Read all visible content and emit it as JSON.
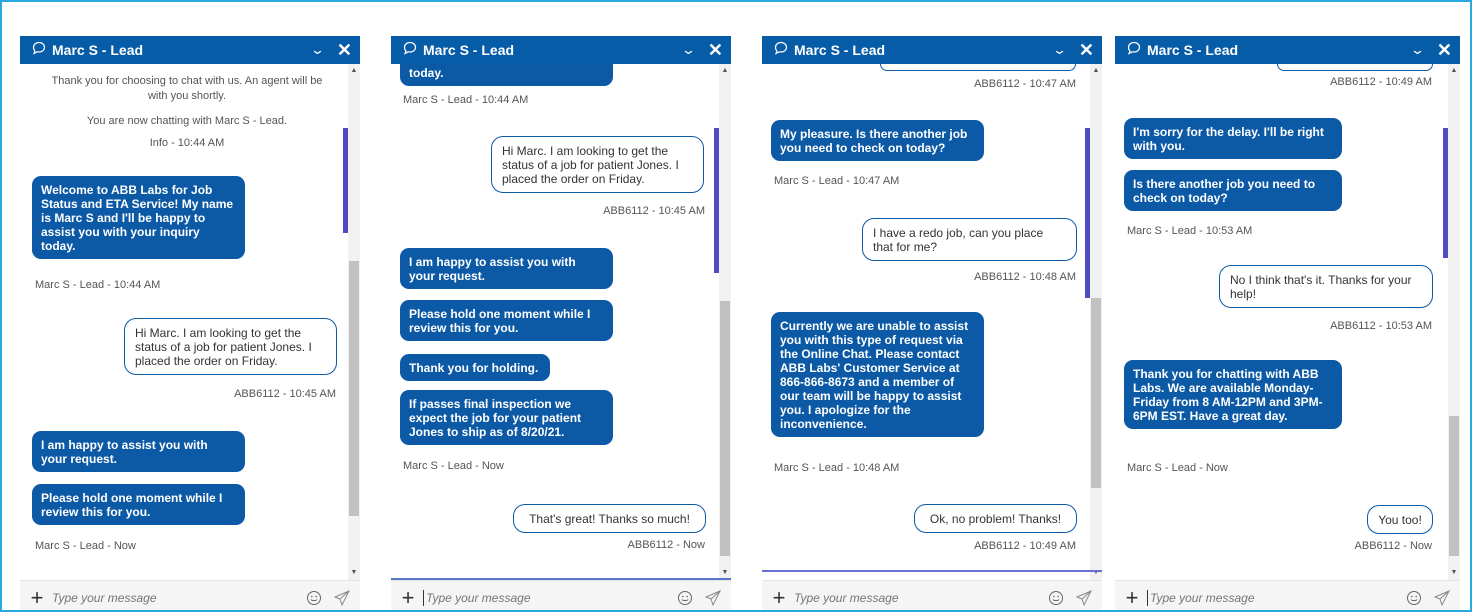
{
  "header": {
    "title": "Marc S - Lead",
    "minimize_glyph": "⌄",
    "close_glyph": "✕"
  },
  "composer": {
    "placeholder": "Type your message",
    "add_glyph": "+"
  },
  "icons": {
    "chat": "speech-bubble-icon",
    "emoji": "smiley-icon",
    "send": "paper-plane-icon"
  },
  "colors": {
    "frame": "#29a9de",
    "header": "#075ca8",
    "agent_bubble": "#0c5aa6",
    "scroll_accent": "#4e4cc0"
  },
  "panels": [
    {
      "system": [
        "Thank you for choosing to chat with us. An agent will be with you shortly.",
        "You are now chatting with Marc S - Lead.",
        "Info - 10:44 AM"
      ],
      "messages": [
        "Welcome to ABB Labs for Job Status and ETA Service! My name is Marc S and I'll be happy to assist you with your inquiry today.",
        "Hi Marc. I am looking to get the status of a job for patient Jones. I placed the order on Friday.",
        "I am happy to assist you with your request.",
        "Please hold one moment while I review this for you."
      ],
      "meta": [
        "Marc S - Lead - 10:44 AM",
        "ABB6112 - 10:45 AM",
        "Marc S - Lead - Now"
      ]
    },
    {
      "cut_text": "today.",
      "messages": [
        "Hi Marc. I am looking to get the status of a job for patient Jones. I placed the order on Friday.",
        "I am happy to assist you with your request.",
        "Please hold one moment while I review this for you.",
        "Thank you for holding.",
        "If passes final inspection we expect the job for your patient Jones to ship as of 8/20/21.",
        "That's great! Thanks so much!"
      ],
      "meta": [
        "Marc S - Lead - 10:44 AM",
        "ABB6112 - 10:45 AM",
        "Marc S - Lead - Now",
        "ABB6112 - Now"
      ]
    },
    {
      "messages": [
        "My pleasure. Is there another job you need to check on today?",
        "I have a redo job, can you place that for me?",
        "Currently we are unable to assist you with this type of request via the Online Chat. Please contact ABB Labs' Customer Service at 866-866-8673 and a member of our team will be happy to assist you. I apologize for the inconvenience.",
        "Ok, no problem! Thanks!"
      ],
      "meta": [
        "ABB6112 - 10:47 AM",
        "Marc S - Lead - 10:47 AM",
        "ABB6112 - 10:48 AM",
        "Marc S - Lead - 10:48 AM",
        "ABB6112 - 10:49 AM"
      ]
    },
    {
      "messages": [
        "I'm sorry for the delay. I'll be right with you.",
        "Is there another job you need to check on today?",
        "No I think that's it. Thanks for your help!",
        "Thank you for chatting with ABB Labs. We are available Monday-Friday from 8 AM-12PM and 3PM-6PM EST. Have a great day.",
        "You too!"
      ],
      "meta": [
        "ABB6112 - 10:49 AM",
        "Marc S - Lead - 10:53 AM",
        "ABB6112 - 10:53 AM",
        "Marc S - Lead - Now",
        "ABB6112 - Now"
      ]
    }
  ]
}
